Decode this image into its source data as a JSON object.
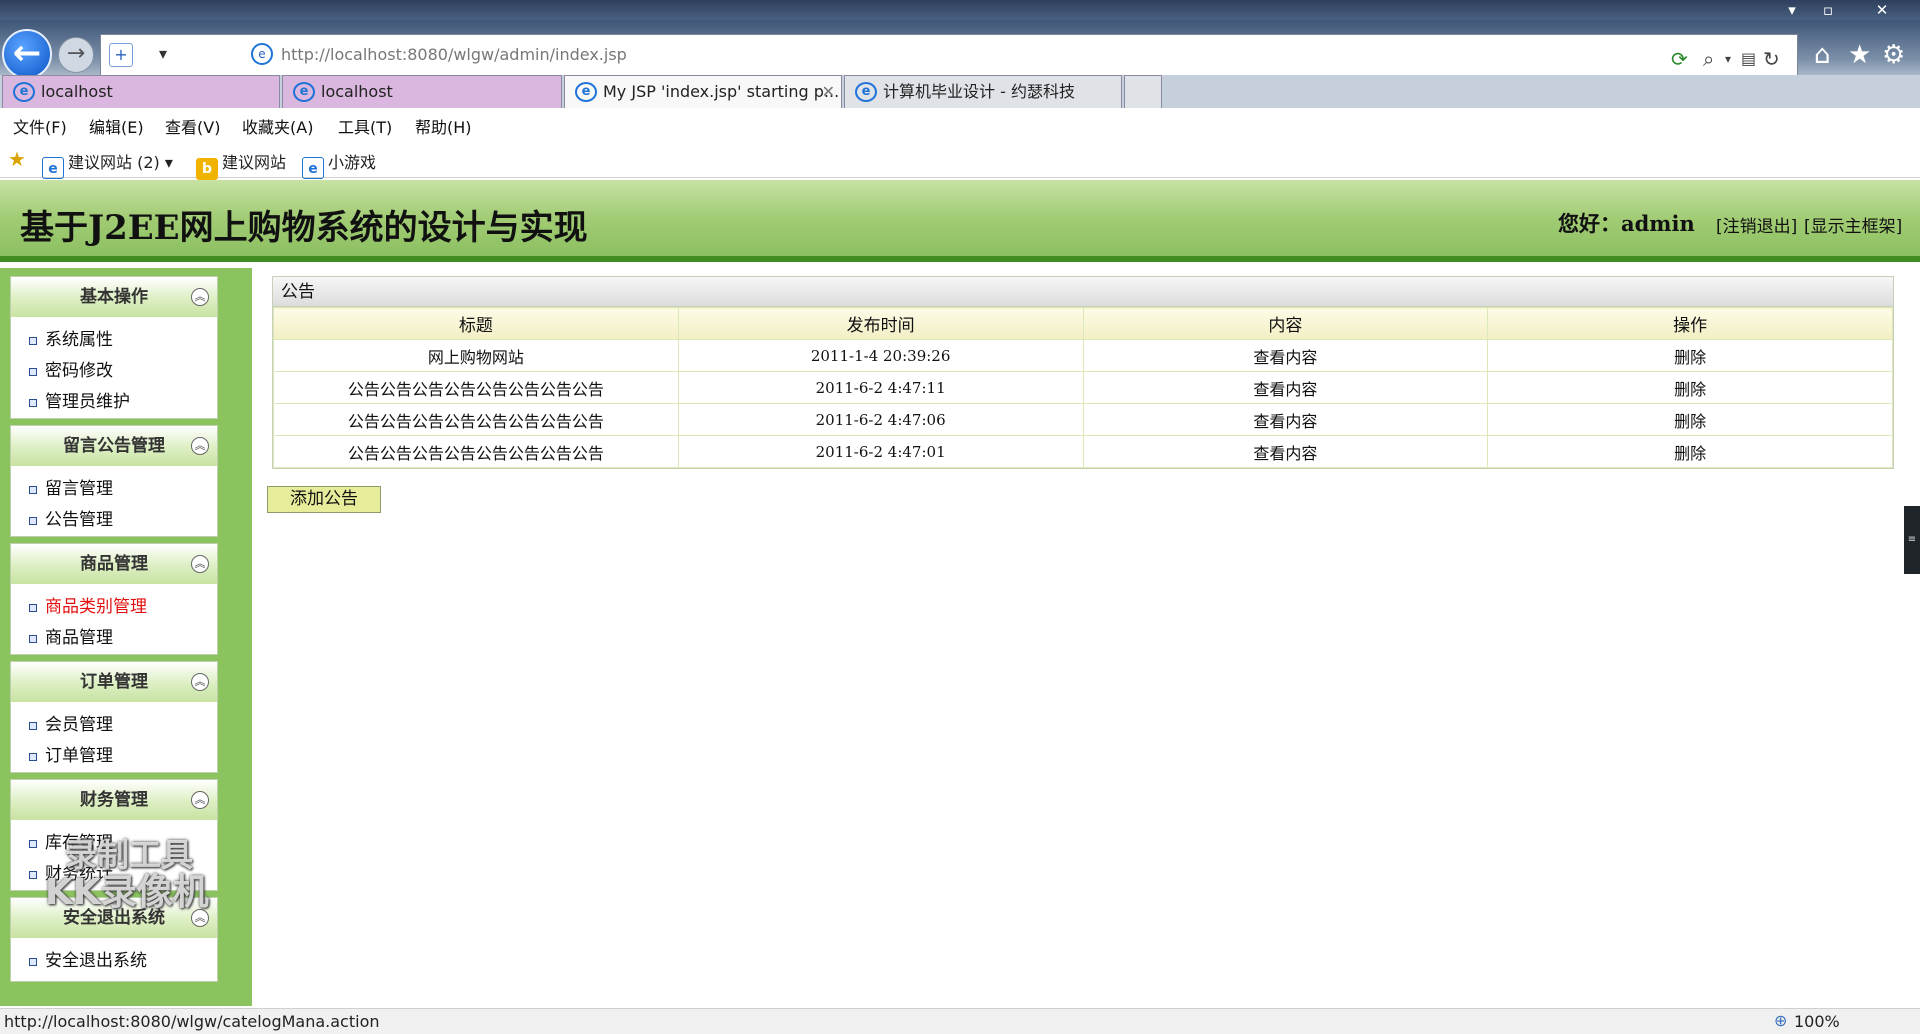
{
  "browser": {
    "url": "http://localhost:8080/wlgw/admin/index.jsp",
    "tabs": [
      {
        "label": "localhost"
      },
      {
        "label": "localhost"
      },
      {
        "label": "My JSP 'index.jsp' starting p..."
      },
      {
        "label": "计算机毕业设计 - 约瑟科技"
      }
    ],
    "menu": [
      "文件(F)",
      "编辑(E)",
      "查看(V)",
      "收藏夹(A)",
      "工具(T)",
      "帮助(H)"
    ],
    "favorites": {
      "suggested_sites_count": "建议网站 (2) ▾",
      "suggested_sites": "建议网站",
      "mini_games": "小游戏"
    },
    "status_url": "http://localhost:8080/wlgw/catelogMana.action",
    "zoom": "100%"
  },
  "header": {
    "title": "基于J2EE网上购物系统的设计与实现",
    "greeting": "您好：admin",
    "logout": "[注销退出]",
    "show_frame": "[显示主框架]"
  },
  "sidebar": {
    "groups": [
      {
        "title": "基本操作",
        "items": [
          "系统属性",
          "密码修改",
          "管理员维护"
        ]
      },
      {
        "title": "留言公告管理",
        "items": [
          "留言管理",
          "公告管理"
        ]
      },
      {
        "title": "商品管理",
        "items": [
          "商品类别管理",
          "商品管理"
        ]
      },
      {
        "title": "订单管理",
        "items": [
          "会员管理",
          "订单管理"
        ]
      },
      {
        "title": "财务管理",
        "items": [
          "库存管理",
          "财务统计"
        ]
      },
      {
        "title": "安全退出系统",
        "items": [
          "安全退出系统"
        ]
      }
    ],
    "collapse_glyph": "︽"
  },
  "notice": {
    "panel_title": "公告",
    "columns": [
      "标题",
      "发布时间",
      "内容",
      "操作"
    ],
    "rows": [
      {
        "title": "网上购物网站",
        "time": "2011-1-4 20:39:26",
        "content": "查看内容",
        "action": "删除"
      },
      {
        "title": "公告公告公告公告公告公告公告公告",
        "time": "2011-6-2 4:47:11",
        "content": "查看内容",
        "action": "删除"
      },
      {
        "title": "公告公告公告公告公告公告公告公告",
        "time": "2011-6-2 4:47:06",
        "content": "查看内容",
        "action": "删除"
      },
      {
        "title": "公告公告公告公告公告公告公告公告",
        "time": "2011-6-2 4:47:01",
        "content": "查看内容",
        "action": "删除"
      }
    ],
    "add_button": "添加公告"
  },
  "watermark": {
    "line1": "录制工具",
    "line2": "KK录像机"
  }
}
